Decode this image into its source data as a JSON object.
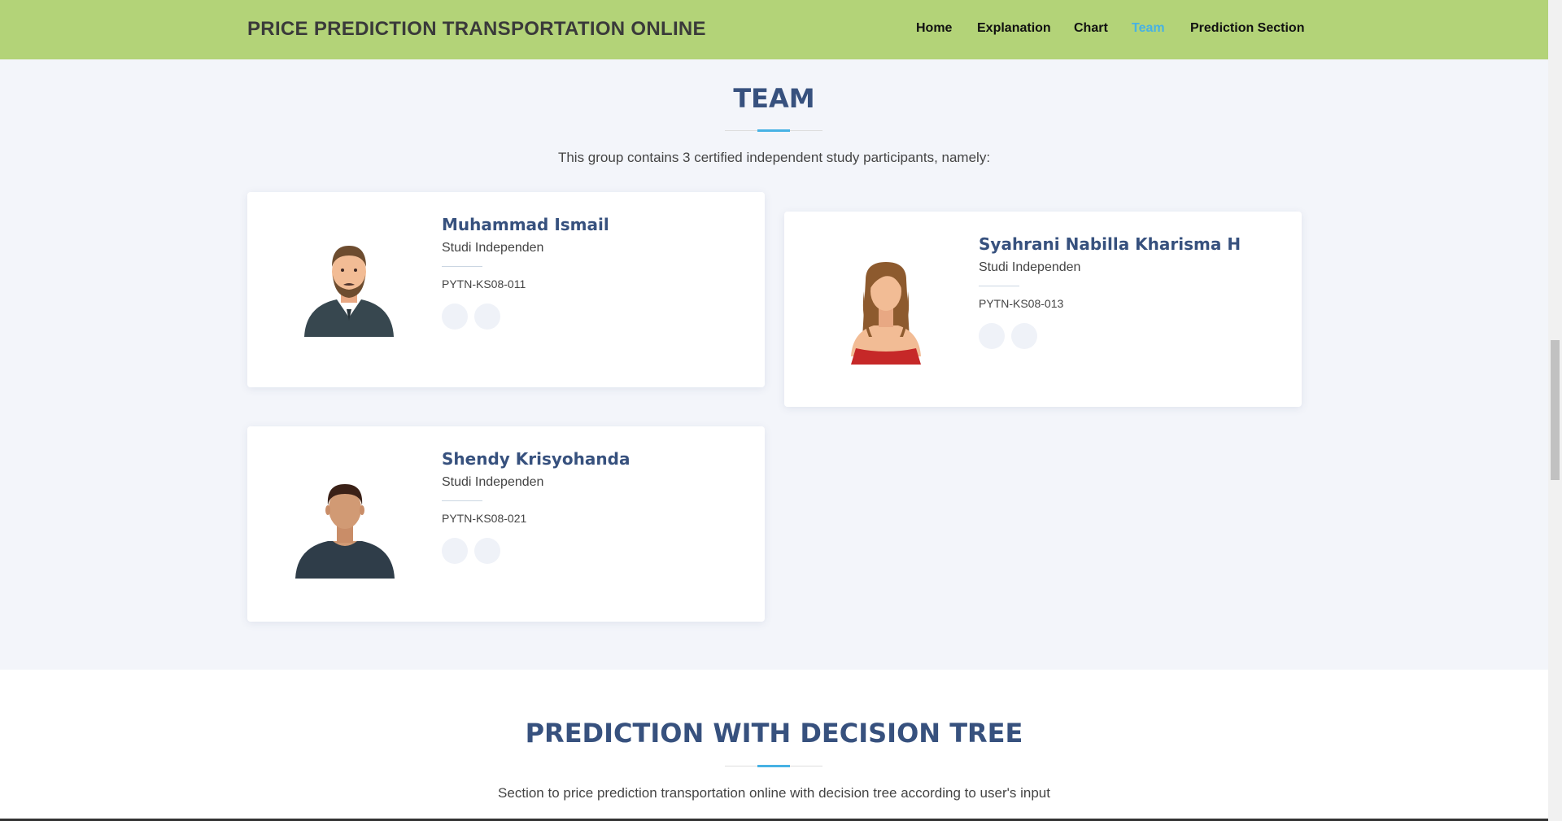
{
  "header": {
    "brand": "PRICE PREDICTION TRANSPORTATION ONLINE",
    "nav": [
      {
        "label": "Home"
      },
      {
        "label": "Explanation"
      },
      {
        "label": "Chart"
      },
      {
        "label": "Team",
        "active": true
      },
      {
        "label": "Prediction Section"
      }
    ],
    "background_color": "#b3d378",
    "active_color": "#47b2e4"
  },
  "team": {
    "title": "TEAM",
    "description": "This group contains 3 certified independent study participants, namely:",
    "members": [
      {
        "name": "Muhammad Ismail",
        "role": "Studi Independen",
        "code": "PYTN-KS08-011",
        "avatar": "bearded-man-avatar-icon"
      },
      {
        "name": "Syahrani Nabilla Kharisma H",
        "role": "Studi Independen",
        "code": "PYTN-KS08-013",
        "avatar": "woman-avatar-icon"
      },
      {
        "name": "Shendy Krisyohanda",
        "role": "Studi Independen",
        "code": "PYTN-KS08-021",
        "avatar": "man-avatar-icon"
      }
    ]
  },
  "prediction": {
    "title": "PREDICTION WITH DECISION TREE",
    "description": "Section to price prediction transportation online with decision tree according to user's input"
  },
  "colors": {
    "heading": "#37517e",
    "accent": "#47b2e4",
    "page_background": "#f3f5fa"
  }
}
